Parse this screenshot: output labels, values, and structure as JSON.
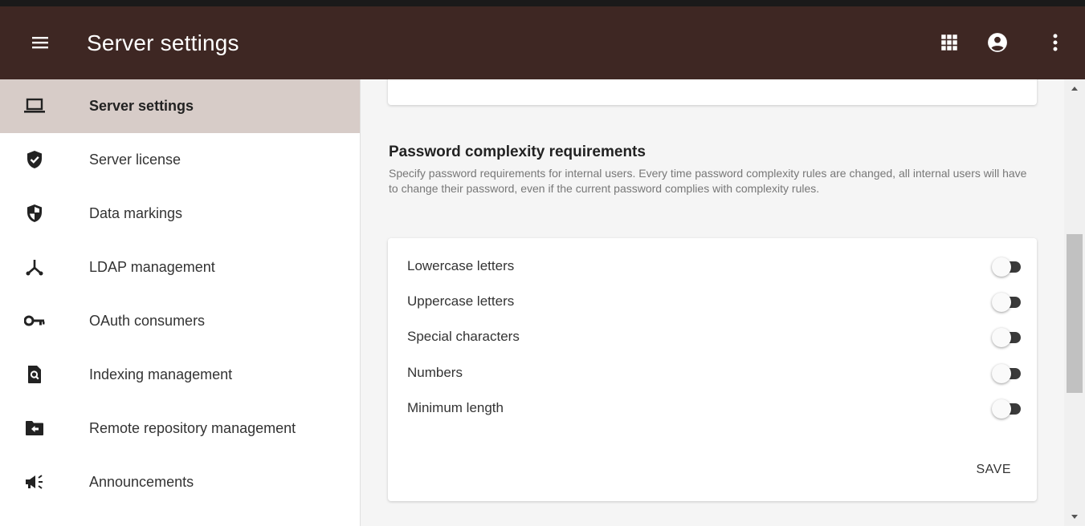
{
  "header": {
    "title": "Server settings",
    "menu_icon": "hamburger-menu-icon",
    "actions": [
      "apps-grid-icon",
      "account-circle-icon",
      "more-vert-icon"
    ],
    "bar_color": "#3e2723"
  },
  "sidebar": {
    "active_color": "#d7ccc8",
    "items": [
      {
        "label": "Server settings",
        "icon": "laptop-icon",
        "active": true
      },
      {
        "label": "Server license",
        "icon": "verified-shield-icon",
        "active": false
      },
      {
        "label": "Data markings",
        "icon": "security-shield-icon",
        "active": false
      },
      {
        "label": "LDAP management",
        "icon": "hierarchy-icon",
        "active": false
      },
      {
        "label": "OAuth consumers",
        "icon": "key-icon",
        "active": false
      },
      {
        "label": "Indexing management",
        "icon": "find-in-page-icon",
        "active": false
      },
      {
        "label": "Remote repository management",
        "icon": "folder-arrow-icon",
        "active": false
      },
      {
        "label": "Announcements",
        "icon": "megaphone-icon",
        "active": false
      }
    ]
  },
  "main": {
    "section_title": "Password complexity requirements",
    "section_description": "Specify password requirements for internal users. Every time password complexity rules are changed, all internal users will have to change their password, even if the current password complies with complexity rules.",
    "options": [
      {
        "label": "Lowercase letters",
        "enabled": false
      },
      {
        "label": "Uppercase letters",
        "enabled": false
      },
      {
        "label": "Special characters",
        "enabled": false
      },
      {
        "label": "Numbers",
        "enabled": false
      },
      {
        "label": "Minimum length",
        "enabled": false
      }
    ],
    "save_label": "SAVE"
  }
}
